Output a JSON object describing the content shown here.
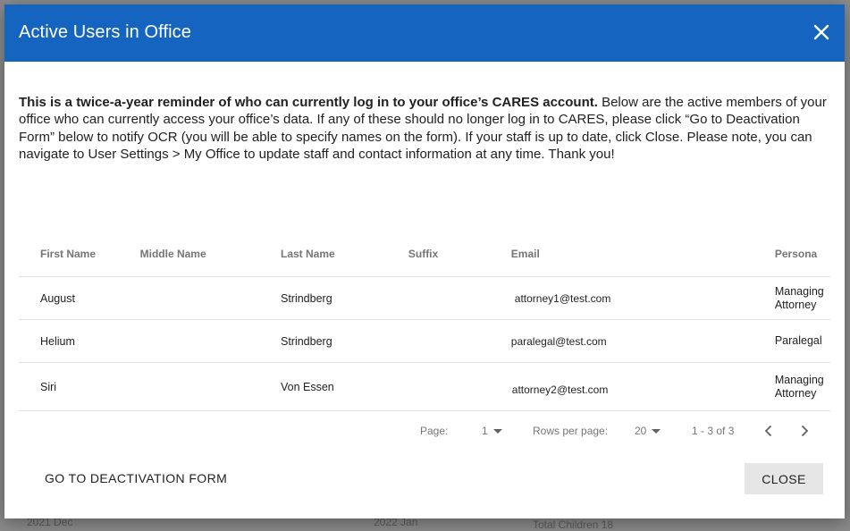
{
  "dialog": {
    "title": "Active Users in Office",
    "close_icon": "close-icon",
    "message_bold": "This is a twice-a-year reminder of who can currently log in to your office’s CARES account.",
    "message_rest": " Below are the active members of your office who can currently access your office’s data. If any of these should no longer log in to CARES, please click “Go to Deactivation Form” below to notify OCR (you will be able to specify names on the form). If your staff is up to date, click Close. Please note, you can navigate to User Settings > My Office to update staff and contact information at any time. Thank you!"
  },
  "table": {
    "columns": [
      "First Name",
      "Middle Name",
      "Last Name",
      "Suffix",
      "Email",
      "Persona"
    ],
    "rows": [
      {
        "first": "August",
        "middle": "",
        "last": "Strindberg",
        "suffix": "",
        "email": "attorney1@test.com",
        "persona": "Managing Attorney"
      },
      {
        "first": "Helium",
        "middle": "",
        "last": "Strindberg",
        "suffix": "",
        "email": "paralegal@test.com",
        "persona": "Paralegal"
      },
      {
        "first": "Siri",
        "middle": "",
        "last": "Von Essen",
        "suffix": "",
        "email": "attorney2@test.com",
        "persona": "Managing Attorney"
      }
    ]
  },
  "pagination": {
    "page_label": "Page:",
    "page_value": "1",
    "rows_label": "Rows per page:",
    "rows_value": "20",
    "range": "1 - 3 of 3",
    "prev_icon": "chevron-left-icon",
    "next_icon": "chevron-right-icon"
  },
  "actions": {
    "deactivation_label": "GO TO DEACTIVATION FORM",
    "close_label": "CLOSE"
  },
  "background": {
    "fragment_left": "2021 Dec",
    "fragment_mid": "2022 Jan",
    "fragment_right": "Total Children 18"
  },
  "colors": {
    "header": "#1565c0",
    "close_button_bg": "#e6e6e6",
    "overlay": "#8a8a8a"
  }
}
